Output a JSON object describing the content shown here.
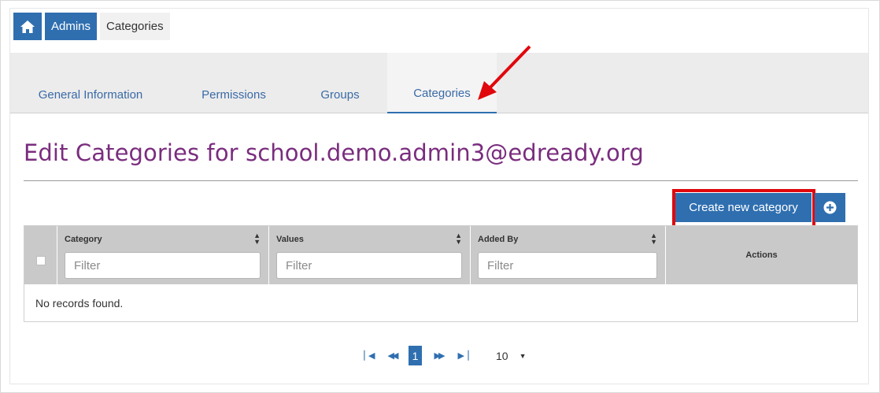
{
  "breadcrumb": {
    "home_icon": "home-icon",
    "admins": "Admins",
    "current": "Categories"
  },
  "tabs": [
    {
      "label": "General Information"
    },
    {
      "label": "Permissions"
    },
    {
      "label": "Groups"
    },
    {
      "label": "Categories",
      "active": true
    }
  ],
  "heading": "Edit Categories for school.demo.admin3@edready.org",
  "toolbar": {
    "create_label": "Create new category",
    "add_icon": "plus-circle-icon"
  },
  "table": {
    "columns": [
      {
        "label": "Category",
        "filter_placeholder": "Filter",
        "sortable": true
      },
      {
        "label": "Values",
        "filter_placeholder": "Filter",
        "sortable": true
      },
      {
        "label": "Added By",
        "filter_placeholder": "Filter",
        "sortable": true
      },
      {
        "label": "Actions",
        "sortable": false
      }
    ],
    "empty_message": "No records found."
  },
  "pagination": {
    "current_page": "1",
    "page_size": "10"
  },
  "colors": {
    "primary": "#2f6fb0",
    "heading": "#7a2d7e",
    "highlight": "#e0080d"
  }
}
